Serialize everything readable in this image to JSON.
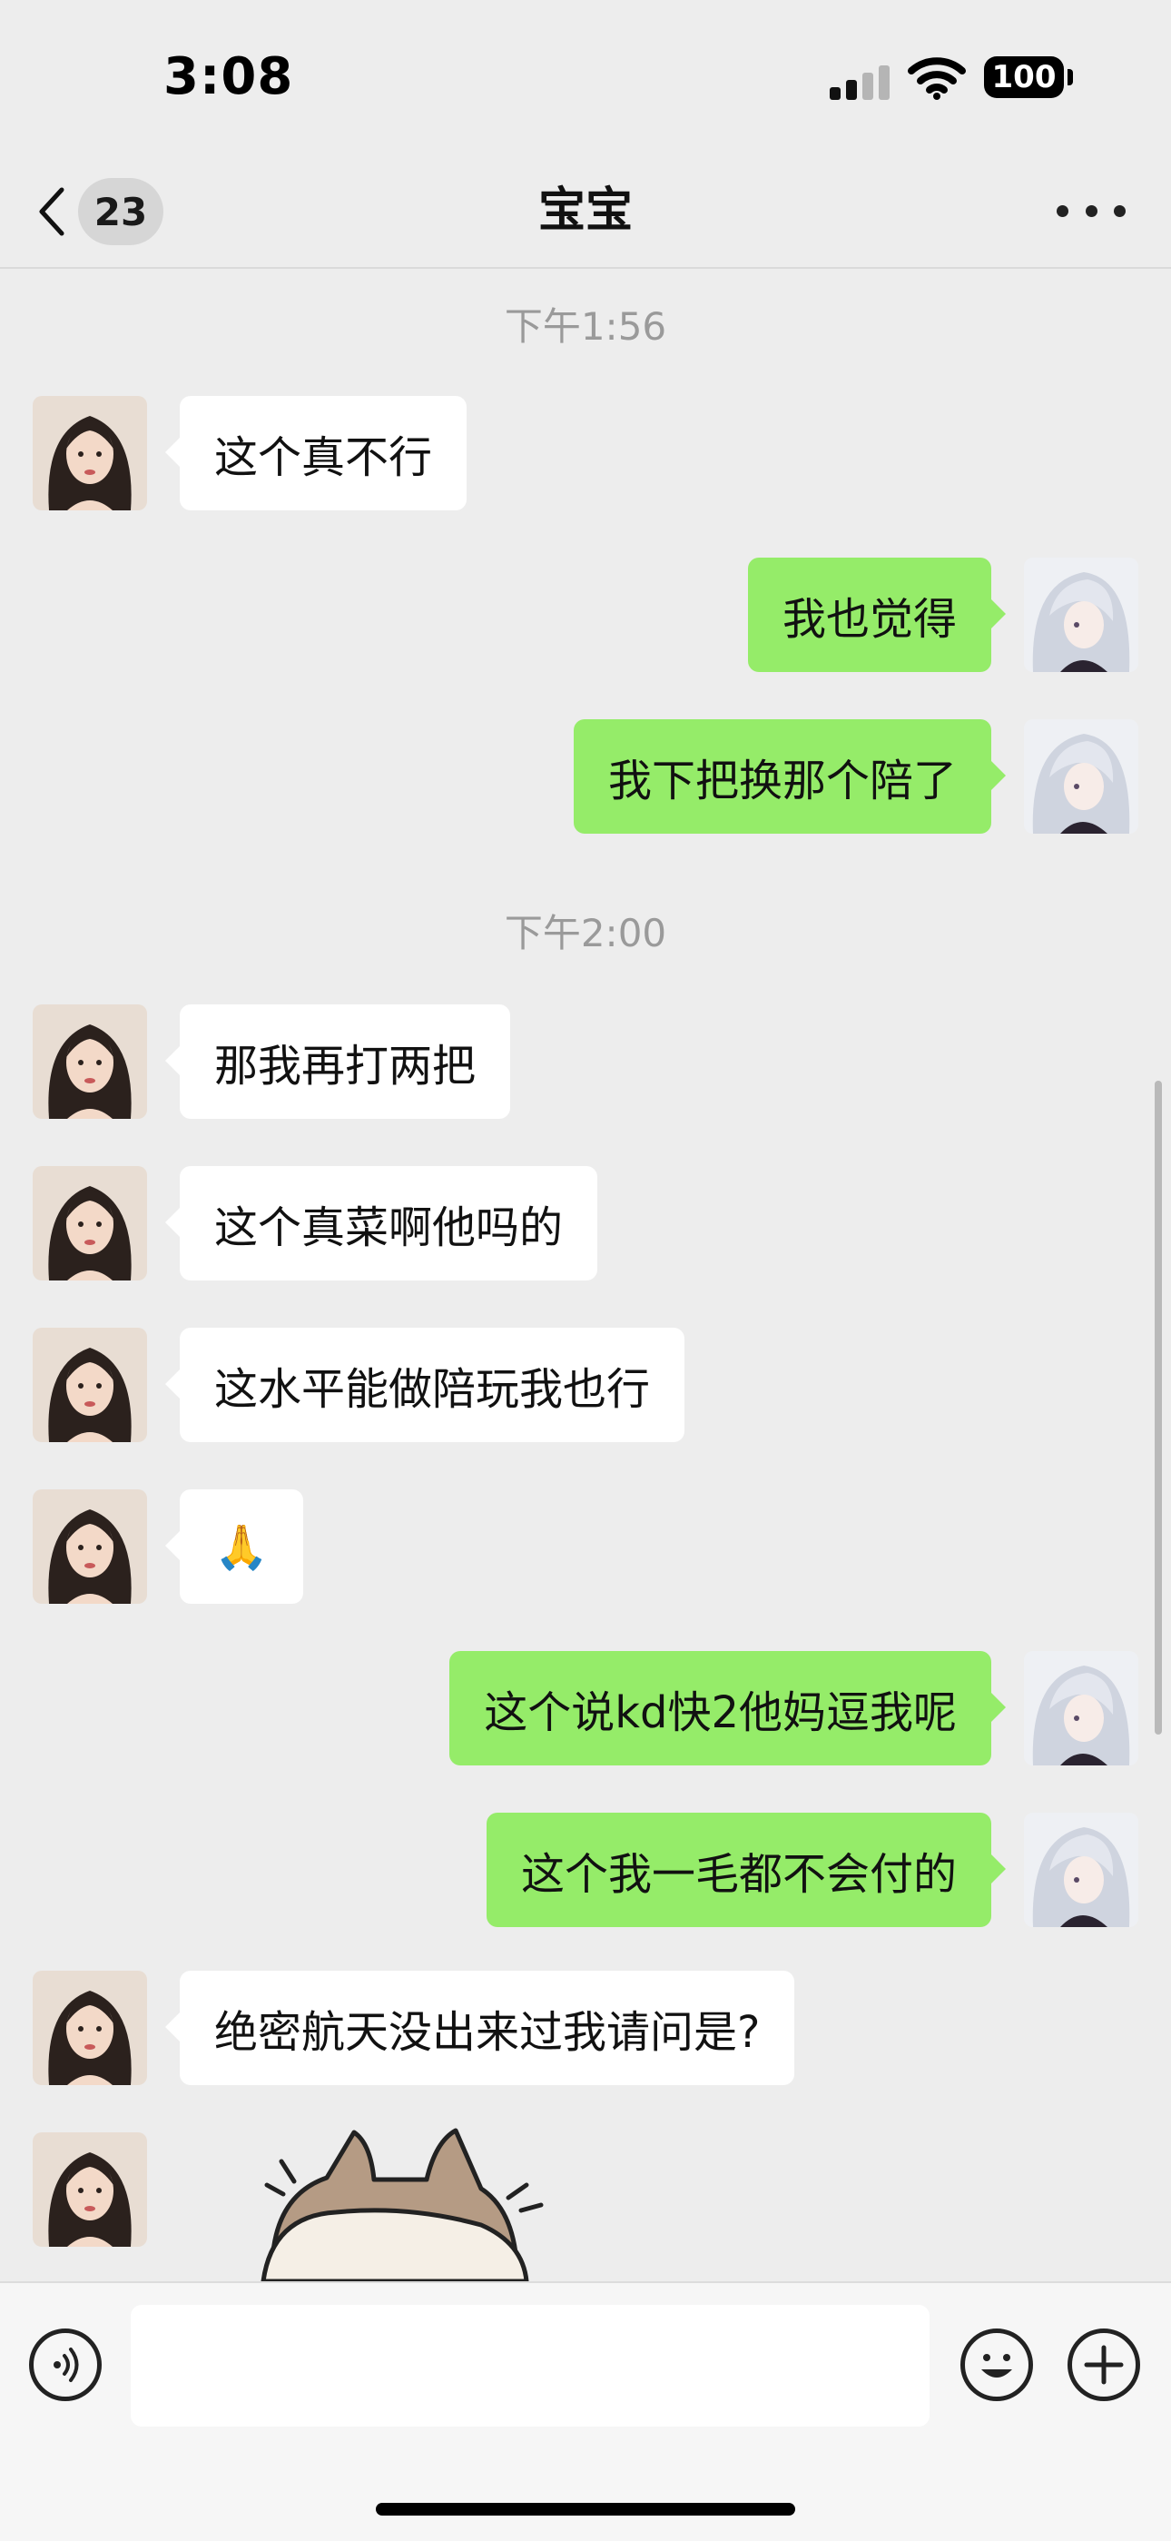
{
  "status_bar": {
    "time": "3:08",
    "battery": "100",
    "icons": [
      "signal-icon",
      "wifi-icon",
      "battery-icon"
    ]
  },
  "nav": {
    "back_icon": "chevron-left-icon",
    "unread_count": "23",
    "title": "宝宝",
    "more_icon": "more-dots-icon"
  },
  "messages": [
    {
      "type": "time",
      "text": "下午1:56"
    },
    {
      "type": "msg",
      "side": "left",
      "text": "这个真不行"
    },
    {
      "type": "msg",
      "side": "right",
      "text": "我也觉得"
    },
    {
      "type": "msg",
      "side": "right",
      "text": "我下把换那个陪了"
    },
    {
      "type": "time",
      "text": "下午2:00"
    },
    {
      "type": "msg",
      "side": "left",
      "text": "那我再打两把"
    },
    {
      "type": "msg",
      "side": "left",
      "text": "这个真菜啊他吗的"
    },
    {
      "type": "msg",
      "side": "left",
      "text": "这水平能做陪玩我也行"
    },
    {
      "type": "msg",
      "side": "left",
      "text": "🙏"
    },
    {
      "type": "msg",
      "side": "right",
      "text": "这个说kd快2他妈逗我呢"
    },
    {
      "type": "msg",
      "side": "right",
      "text": "这个我一毛都不会付的"
    },
    {
      "type": "msg",
      "side": "left",
      "text": "绝密航天没出来过我请问是?"
    },
    {
      "type": "sticker",
      "side": "left",
      "icon": "cat-sticker-icon"
    }
  ],
  "input_bar": {
    "voice_icon": "voice-icon",
    "placeholder": "",
    "emoji_icon": "emoji-icon",
    "plus_icon": "plus-icon"
  },
  "colors": {
    "background": "#ededed",
    "sent_bubble": "#95ec69",
    "received_bubble": "#ffffff",
    "timestamp": "#9a9a9a"
  }
}
